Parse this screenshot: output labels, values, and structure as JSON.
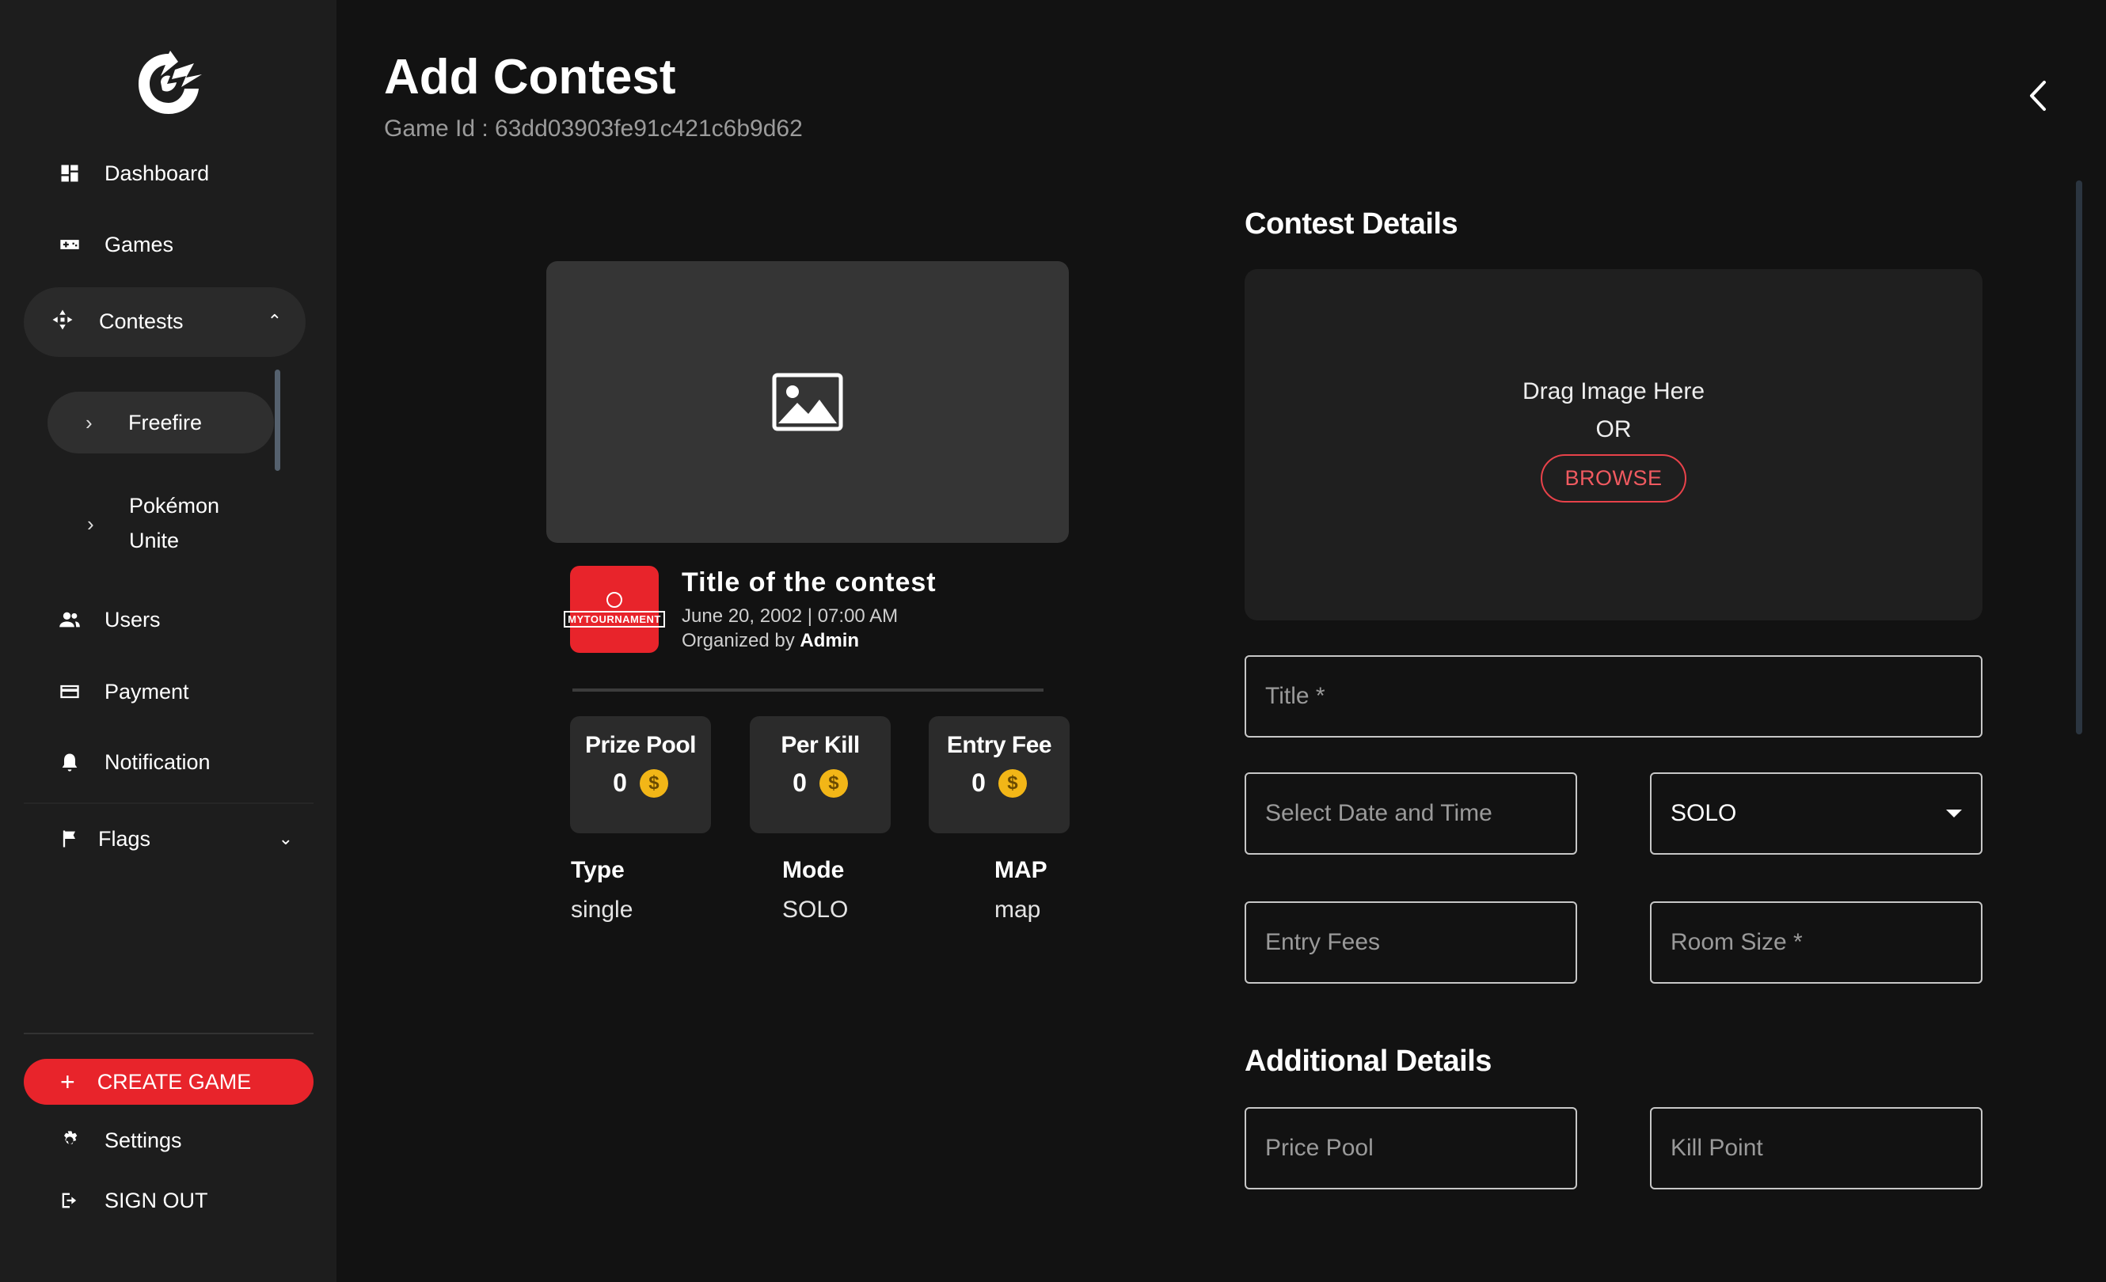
{
  "sidebar": {
    "items": [
      {
        "label": "Dashboard",
        "icon": "dashboard-icon"
      },
      {
        "label": "Games",
        "icon": "gamepad-icon"
      },
      {
        "label": "Contests",
        "icon": "contest-icon"
      },
      {
        "label": "Users",
        "icon": "users-icon"
      },
      {
        "label": "Payment",
        "icon": "card-icon"
      },
      {
        "label": "Notification",
        "icon": "bell-icon"
      },
      {
        "label": "Flags",
        "icon": "flag-icon"
      }
    ],
    "contest_sub": [
      "Freefire",
      "Pokémon Unite"
    ],
    "create_label": "CREATE GAME",
    "settings_label": "Settings",
    "signout_label": "SIGN OUT"
  },
  "header": {
    "title": "Add Contest",
    "game_id": "Game Id : 63dd03903fe91c421c6b9d62"
  },
  "preview": {
    "title": "Title of the contest",
    "date": "June 20, 2002 | 07:00 AM",
    "organized_prefix": "Organized by ",
    "organizer": "Admin",
    "brand_text": "MYTOURNAMENT",
    "stats": [
      {
        "label": "Prize Pool",
        "value": "0"
      },
      {
        "label": "Per Kill",
        "value": "0"
      },
      {
        "label": "Entry Fee",
        "value": "0"
      }
    ],
    "coin_symbol": "$",
    "meta": [
      {
        "label": "Type",
        "value": "single"
      },
      {
        "label": "Mode",
        "value": "SOLO"
      },
      {
        "label": "MAP",
        "value": "map"
      }
    ]
  },
  "form": {
    "contest_details_title": "Contest Details",
    "drag_text": "Drag Image Here",
    "or_text": "OR",
    "browse_label": "BROWSE",
    "title_placeholder": "Title *",
    "date_placeholder": "Select Date and Time",
    "mode_value": "SOLO",
    "entry_fees_placeholder": "Entry Fees",
    "room_size_placeholder": "Room Size *",
    "additional_title": "Additional Details",
    "price_pool_placeholder": "Price Pool",
    "kill_point_placeholder": "Kill Point"
  },
  "colors": {
    "accent": "#e8242b",
    "background": "#121212",
    "sidebar": "#1d1d1d",
    "coin": "#f2b617"
  }
}
